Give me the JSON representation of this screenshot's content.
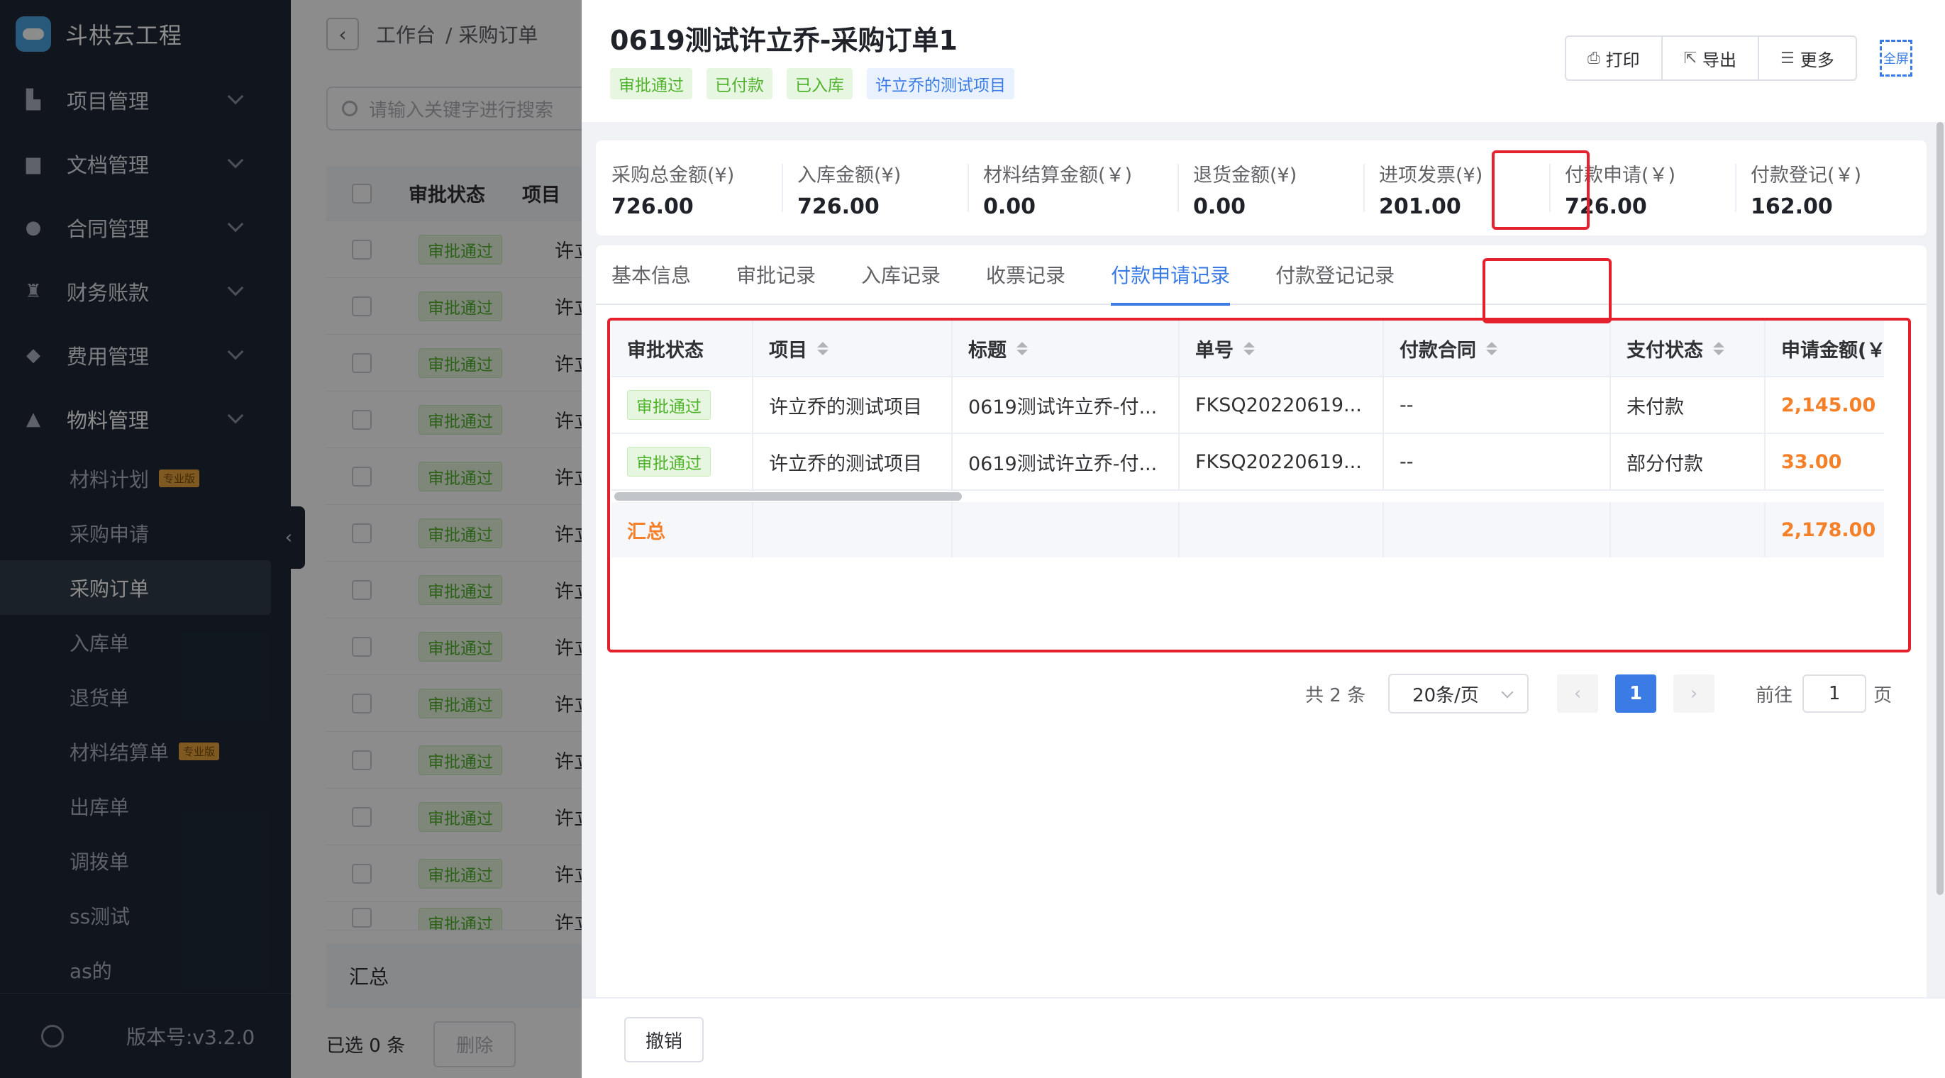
{
  "sidebar": {
    "brand": "斗栱云工程",
    "menu": [
      {
        "label": "项目管理",
        "icon": "building-icon"
      },
      {
        "label": "文档管理",
        "icon": "folder-icon"
      },
      {
        "label": "合同管理",
        "icon": "user-icon"
      },
      {
        "label": "财务账款",
        "icon": "money-bag-icon"
      },
      {
        "label": "费用管理",
        "icon": "shield-icon"
      },
      {
        "label": "物料管理",
        "icon": "warehouse-icon"
      }
    ],
    "submenu": [
      {
        "label": "材料计划",
        "badge": "专业版"
      },
      {
        "label": "采购申请",
        "badge": ""
      },
      {
        "label": "采购订单",
        "badge": ""
      },
      {
        "label": "入库单",
        "badge": ""
      },
      {
        "label": "退货单",
        "badge": ""
      },
      {
        "label": "材料结算单",
        "badge": "专业版"
      },
      {
        "label": "出库单",
        "badge": ""
      },
      {
        "label": "调拨单",
        "badge": ""
      },
      {
        "label": "ss测试",
        "badge": ""
      },
      {
        "label": "as的",
        "badge": ""
      }
    ],
    "active_submenu": "采购订单",
    "version": "版本号:v3.2.0"
  },
  "background_page": {
    "breadcrumb_home": "工作台",
    "breadcrumb_current": "/ 采购订单",
    "search_placeholder": "请输入关键字进行搜索",
    "table_header_status": "审批状态",
    "table_header_project": "项目",
    "row_status": "审批通过",
    "row_project": "许立",
    "summary_label": "汇总",
    "selected_text": "已选 0 条",
    "delete_label": "删除"
  },
  "drawer": {
    "title": "0619测试许立乔-采购订单1",
    "tags": [
      {
        "label": "审批通过",
        "style": "green"
      },
      {
        "label": "已付款",
        "style": "green"
      },
      {
        "label": "已入库",
        "style": "green"
      },
      {
        "label": "许立乔的测试项目",
        "style": "blue"
      }
    ],
    "actions": {
      "print": "打印",
      "export": "导出",
      "more": "更多",
      "fullscreen": "全屏"
    },
    "stats": [
      {
        "label": "采购总金额(¥)",
        "value": "726.00"
      },
      {
        "label": "入库金额(¥)",
        "value": "726.00"
      },
      {
        "label": "材料结算金额(￥)",
        "value": "0.00"
      },
      {
        "label": "退货金额(¥)",
        "value": "0.00"
      },
      {
        "label": "进项发票(¥)",
        "value": "201.00"
      },
      {
        "label": "付款申请(￥)",
        "value": "726.00"
      },
      {
        "label": "付款登记(￥)",
        "value": "162.00"
      }
    ],
    "tabs": [
      "基本信息",
      "审批记录",
      "入库记录",
      "收票记录",
      "付款申请记录",
      "付款登记记录"
    ],
    "active_tab": "付款申请记录",
    "table": {
      "columns": [
        "审批状态",
        "项目",
        "标题",
        "单号",
        "付款合同",
        "支付状态",
        "申请金额(￥"
      ],
      "rows": [
        {
          "status": "审批通过",
          "project": "许立乔的测试项目",
          "title": "0619测试许立乔-付...",
          "number": "FKSQ20220619...",
          "contract": "--",
          "pay_status": "未付款",
          "amount": "2,145.00"
        },
        {
          "status": "审批通过",
          "project": "许立乔的测试项目",
          "title": "0619测试许立乔-付...",
          "number": "FKSQ20220619...",
          "contract": "--",
          "pay_status": "部分付款",
          "amount": "33.00"
        }
      ],
      "summary_label": "汇总",
      "summary_amount": "2,178.00"
    },
    "pagination": {
      "total": "共 2 条",
      "page_size": "20条/页",
      "current_page": "1",
      "goto_label": "前往",
      "goto_value": "1",
      "page_unit": "页"
    },
    "footer": {
      "cancel_label": "撤销"
    }
  },
  "colors": {
    "accent": "#3a7be5",
    "highlight_box": "#e5212d",
    "amount": "#f5802a",
    "approved_tag": "#4fb32c",
    "sidebar_bg": "#1f2937"
  }
}
